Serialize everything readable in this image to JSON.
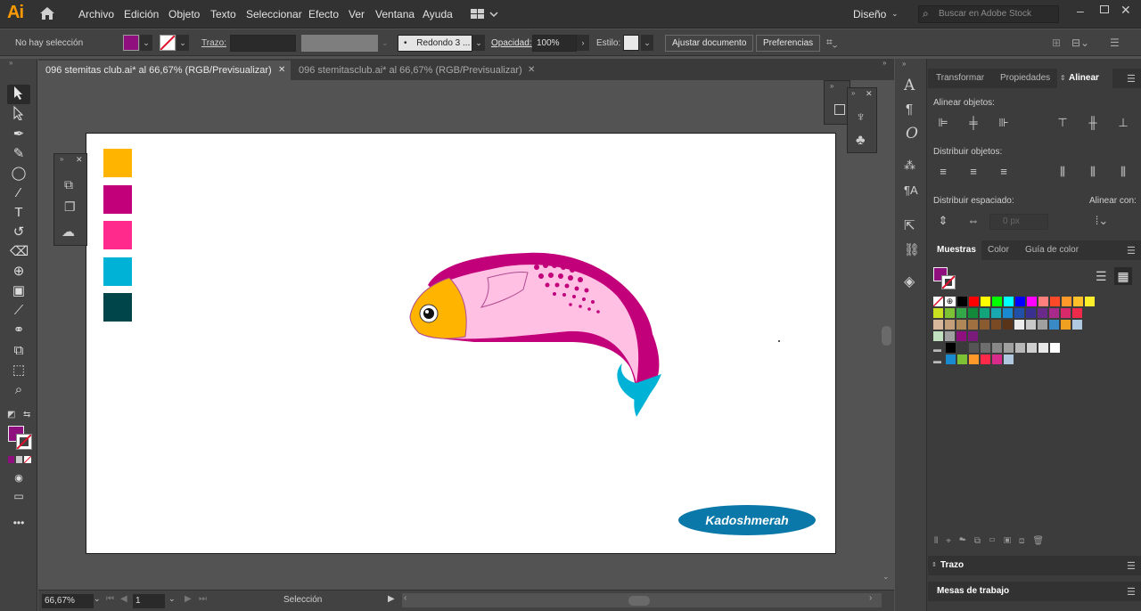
{
  "app": {
    "logo": "Ai"
  },
  "menubar": {
    "items": [
      "Archivo",
      "Edición",
      "Objeto",
      "Texto",
      "Seleccionar",
      "Efecto",
      "Ver",
      "Ventana",
      "Ayuda"
    ],
    "workspace": "Diseño",
    "search_placeholder": "Buscar en Adobe Stock"
  },
  "control": {
    "selection_label": "No hay selección",
    "fill_color": "#8e0f7d",
    "stroke_label": "Trazo:",
    "brush": "Redondo 3 ...",
    "opacity_label": "Opacidad:",
    "opacity_value": "100%",
    "style_label": "Estilo:",
    "doc_setup": "Ajustar documento",
    "prefs": "Preferencias"
  },
  "tabs": [
    {
      "label": "096 stemitas club.ai* al 66,67% (RGB/Previsualizar)",
      "active": true
    },
    {
      "label": "096 stemitasclub.ai* al 66,67% (RGB/Previsualizar)",
      "active": false
    }
  ],
  "artboard": {
    "swatches": [
      "#ffb400",
      "#c2007a",
      "#ff2a8c",
      "#00b3d6",
      "#00454a"
    ],
    "watermark": "Kadoshmerah"
  },
  "status": {
    "zoom": "66,67%",
    "page": "1",
    "tool": "Selección"
  },
  "right": {
    "top_tabs": [
      "Transformar",
      "Propiedades",
      "Alinear"
    ],
    "align_objects": "Alinear objetos:",
    "distribute_objects": "Distribuir objetos:",
    "distribute_spacing": "Distribuir espaciado:",
    "align_to": "Alinear con:",
    "spacing_value": "0 px",
    "swatch_tabs": [
      "Muestras",
      "Color",
      "Guía de color"
    ],
    "stroke_panel": "Trazo",
    "artboards_panel": "Mesas de trabajo"
  },
  "swatch_rows": [
    [
      "#ffffff",
      "#000000",
      "#ff0000",
      "#ffff00",
      "#00ff00",
      "#00ffff",
      "#0000ff",
      "#ff00ff",
      "#ff7f7f",
      "#ff4a2a",
      "#ff9a2a",
      "#ffc02a",
      "#ffee2a"
    ],
    [
      "#c8e020",
      "#7cc234",
      "#34a848",
      "#128a3a",
      "#12a47a",
      "#18a8b0",
      "#1a8ad0",
      "#2050a8",
      "#3a3090",
      "#6a2a8a",
      "#a82a8a",
      "#d82a6a",
      "#f02a4a"
    ],
    [
      "#d8b89a",
      "#c4a07a",
      "#b08858",
      "#a07040",
      "#8a5a30",
      "#7a4a24",
      "#5a3418",
      "#ececec",
      "#c9c9c9",
      "#a0a0a0",
      "#3a8ac8",
      "#f0a020",
      "#b0c8e0"
    ],
    [
      "#c0e0c0",
      "#a0a0a0",
      "#8e0f7d",
      "#7a1a7a"
    ],
    [
      "#000000",
      "#3a3a3a",
      "#555555",
      "#6e6e6e",
      "#888888",
      "#a0a0a0",
      "#b8b8b8",
      "#d0d0d0",
      "#e8e8e8",
      "#ffffff"
    ],
    [
      "#1a8ad0",
      "#7cc234",
      "#ff9a2a",
      "#ff2a4a",
      "#d82a8a",
      "#b0c8e0"
    ]
  ]
}
